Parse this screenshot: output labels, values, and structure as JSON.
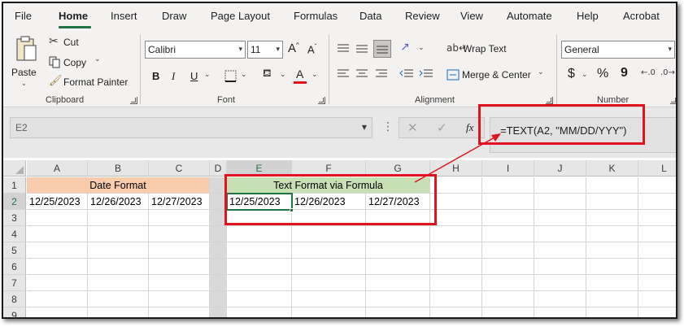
{
  "menu": {
    "tabs": [
      "File",
      "Home",
      "Insert",
      "Draw",
      "Page Layout",
      "Formulas",
      "Data",
      "Review",
      "View",
      "Automate",
      "Help",
      "Acrobat"
    ],
    "active": "Home"
  },
  "ribbon": {
    "clipboard": {
      "label": "Clipboard",
      "paste": "Paste",
      "cut": "Cut",
      "copy": "Copy",
      "format_painter": "Format Painter"
    },
    "font": {
      "label": "Font",
      "font_name": "Calibri",
      "font_size": "11",
      "bold": "B",
      "italic": "I",
      "underline": "U",
      "grow": "A",
      "shrink": "A",
      "font_color": "A"
    },
    "alignment": {
      "label": "Alignment",
      "wrap_text": "Wrap Text",
      "merge_center": "Merge & Center"
    },
    "number": {
      "label": "Number",
      "format": "General",
      "currency": "$",
      "percent": "%",
      "comma": "9"
    }
  },
  "formula_bar": {
    "name_box": "E2",
    "fx": "fx",
    "formula": "=TEXT(A2, \"MM/DD/YYY\")"
  },
  "sheet": {
    "columns": [
      "A",
      "B",
      "C",
      "D",
      "E",
      "F",
      "G",
      "H",
      "I",
      "J",
      "K",
      "L"
    ],
    "selected_column": "E",
    "rows": [
      "1",
      "2",
      "3",
      "4",
      "5",
      "6",
      "7",
      "8",
      "9"
    ],
    "selected_row": "2",
    "date_format_header": "Date Format",
    "text_format_header": "Text Format via Formula",
    "row2": {
      "A": "12/25/2023",
      "B": "12/26/2023",
      "C": "12/27/2023",
      "E": "12/25/2023",
      "F": "12/26/2023",
      "G": "12/27/2023"
    }
  },
  "colors": {
    "accent": "#217346",
    "date_header_fill": "#f8cbad",
    "text_header_fill": "#c6e0b4",
    "annotation": "#e0141e"
  }
}
